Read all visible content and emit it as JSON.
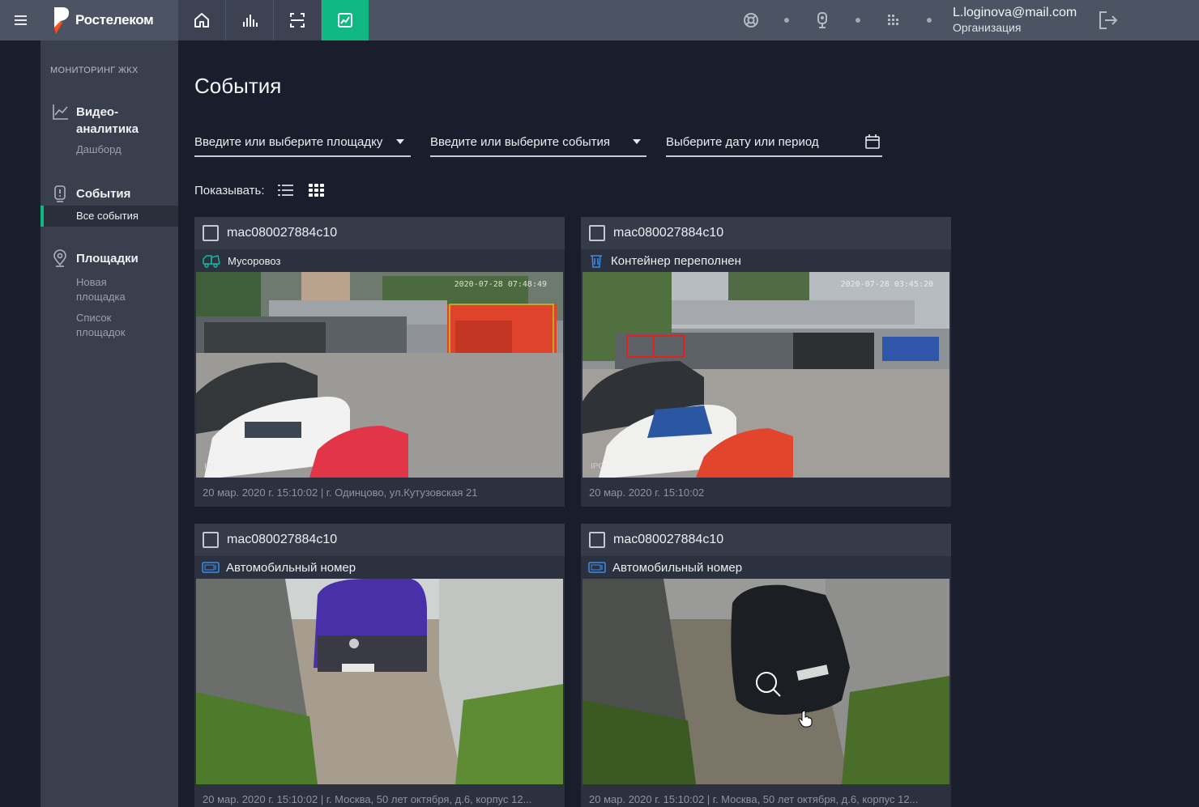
{
  "topbar": {
    "brand": "Ростелеком",
    "nav_icons": [
      "home-icon",
      "bar-chart-icon",
      "scan-icon",
      "analytics-icon"
    ],
    "right_icons": [
      "lifebuoy-icon",
      "camera-icon",
      "building-icon"
    ],
    "user_email": "L.loginova@mail.com",
    "user_org": "Организация",
    "accent": "#10b981"
  },
  "sidebar": {
    "section": "МОНИТОРИНГ ЖКХ",
    "groups": [
      {
        "title_line1": "Видео-",
        "title_line2": "аналитика",
        "items": [
          "Дашборд"
        ]
      },
      {
        "title": "События",
        "items": [
          "Все события"
        ]
      },
      {
        "title": "Площадки",
        "items": [
          [
            "Новая",
            "площадка"
          ],
          [
            "Список",
            "площадок"
          ]
        ]
      }
    ]
  },
  "main": {
    "title": "События",
    "filters": {
      "site": "Введите или выберите площадку",
      "event": "Введите или выберите события",
      "date": "Выберите дату или период"
    },
    "show_label": "Показывать:"
  },
  "cards": [
    {
      "id": "mac080027884c10",
      "type": "Мусоровоз",
      "type_icon": "garbage-truck-icon",
      "timestamp": "2020-07-28 07:48:49",
      "footer": "20 мар. 2020 г. 15:10:02 | г. Одинцово, ул.Кутузовская 21"
    },
    {
      "id": "mac080027884c10",
      "type": "Контейнер переполнен",
      "type_icon": "trash-bin-icon",
      "timestamp": "2020-07-28 03:45:20",
      "footer": "20 мар. 2020 г. 15:10:02"
    },
    {
      "id": "mac080027884c10",
      "type": "Автомобильный номер",
      "type_icon": "license-plate-icon",
      "footer": "20 мар. 2020 г. 15:10:02 | г. Москва, 50 лет октября, д.6, корпус 12..."
    },
    {
      "id": "mac080027884c10",
      "type": "Автомобильный номер",
      "type_icon": "license-plate-icon",
      "footer": "20 мар. 2020 г. 15:10:02 | г. Москва, 50 лет октября, д.6, корпус 12..."
    }
  ],
  "camera_overlay": "IPC"
}
